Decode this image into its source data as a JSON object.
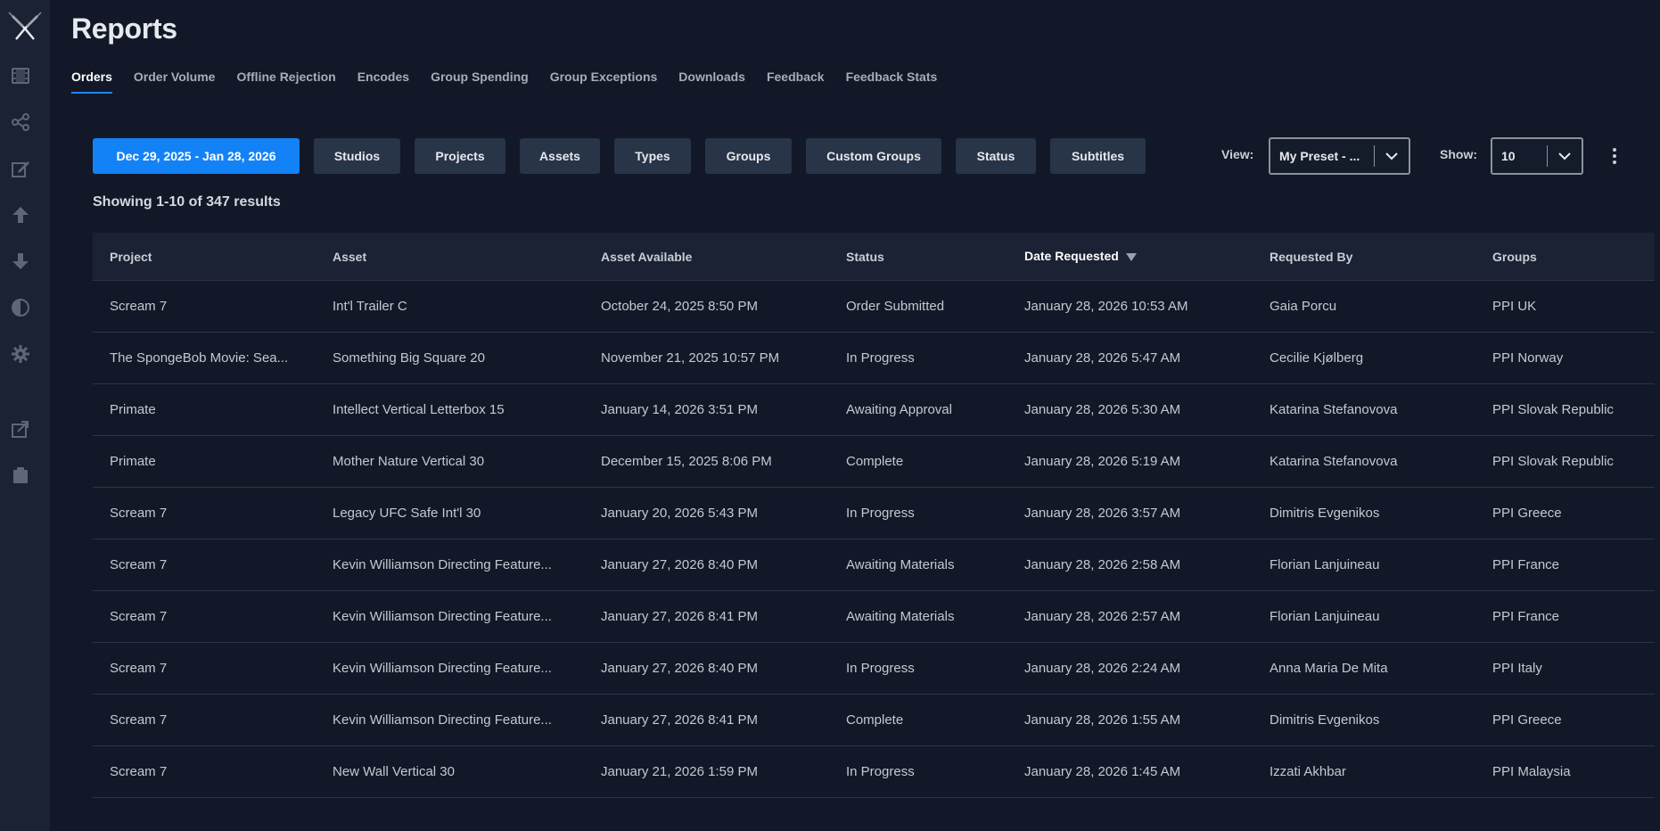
{
  "page": {
    "title": "Reports"
  },
  "sidebar": {
    "icons": [
      "logo-icon",
      "film-icon",
      "share-icon",
      "edit-icon",
      "upload-icon",
      "download-icon",
      "contrast-icon",
      "gear-icon",
      "export-icon",
      "clipboard-icon"
    ]
  },
  "tabs": [
    {
      "label": "Orders",
      "active": true
    },
    {
      "label": "Order Volume"
    },
    {
      "label": "Offline Rejection"
    },
    {
      "label": "Encodes"
    },
    {
      "label": "Group Spending"
    },
    {
      "label": "Group Exceptions"
    },
    {
      "label": "Downloads"
    },
    {
      "label": "Feedback"
    },
    {
      "label": "Feedback Stats"
    }
  ],
  "filters": {
    "date_range": "Dec 29, 2025 - Jan 28, 2026",
    "studios": "Studios",
    "projects": "Projects",
    "assets": "Assets",
    "types": "Types",
    "groups": "Groups",
    "custom_groups": "Custom Groups",
    "status": "Status",
    "subtitles": "Subtitles"
  },
  "view": {
    "label": "View:",
    "value": "My Preset - ..."
  },
  "show": {
    "label": "Show:",
    "value": "10"
  },
  "results_text": "Showing 1-10 of 347 results",
  "table": {
    "columns": {
      "project": "Project",
      "asset": "Asset",
      "asset_available": "Asset Available",
      "status": "Status",
      "date_requested": "Date Requested",
      "requested_by": "Requested By",
      "groups": "Groups"
    },
    "rows": [
      {
        "project": "Scream 7",
        "asset": "Int'l Trailer C",
        "asset_available": "October 24, 2025 8:50 PM",
        "status": "Order Submitted",
        "date_requested": "January 28, 2026 10:53 AM",
        "requested_by": "Gaia Porcu",
        "groups": "PPI UK"
      },
      {
        "project": "The SpongeBob Movie: Sea...",
        "asset": "Something Big Square 20",
        "asset_available": "November 21, 2025 10:57 PM",
        "status": "In Progress",
        "date_requested": "January 28, 2026 5:47 AM",
        "requested_by": "Cecilie Kjølberg",
        "groups": "PPI Norway"
      },
      {
        "project": "Primate",
        "asset": "Intellect Vertical Letterbox 15",
        "asset_available": "January 14, 2026 3:51 PM",
        "status": "Awaiting Approval",
        "date_requested": "January 28, 2026 5:30 AM",
        "requested_by": "Katarina Stefanovova",
        "groups": "PPI Slovak Republic"
      },
      {
        "project": "Primate",
        "asset": "Mother Nature Vertical 30",
        "asset_available": "December 15, 2025 8:06 PM",
        "status": "Complete",
        "date_requested": "January 28, 2026 5:19 AM",
        "requested_by": "Katarina Stefanovova",
        "groups": "PPI Slovak Republic"
      },
      {
        "project": "Scream 7",
        "asset": "Legacy UFC Safe Int'l 30",
        "asset_available": "January 20, 2026 5:43 PM",
        "status": "In Progress",
        "date_requested": "January 28, 2026 3:57 AM",
        "requested_by": "Dimitris Evgenikos",
        "groups": "PPI Greece"
      },
      {
        "project": "Scream 7",
        "asset": "Kevin Williamson Directing Feature...",
        "asset_available": "January 27, 2026 8:40 PM",
        "status": "Awaiting Materials",
        "date_requested": "January 28, 2026 2:58 AM",
        "requested_by": "Florian Lanjuineau",
        "groups": "PPI France"
      },
      {
        "project": "Scream 7",
        "asset": "Kevin Williamson Directing Feature...",
        "asset_available": "January 27, 2026 8:41 PM",
        "status": "Awaiting Materials",
        "date_requested": "January 28, 2026 2:57 AM",
        "requested_by": "Florian Lanjuineau",
        "groups": "PPI France"
      },
      {
        "project": "Scream 7",
        "asset": "Kevin Williamson Directing Feature...",
        "asset_available": "January 27, 2026 8:40 PM",
        "status": "In Progress",
        "date_requested": "January 28, 2026 2:24 AM",
        "requested_by": "Anna Maria De Mita",
        "groups": "PPI Italy"
      },
      {
        "project": "Scream 7",
        "asset": "Kevin Williamson Directing Feature...",
        "asset_available": "January 27, 2026 8:41 PM",
        "status": "Complete",
        "date_requested": "January 28, 2026 1:55 AM",
        "requested_by": "Dimitris Evgenikos",
        "groups": "PPI Greece"
      },
      {
        "project": "Scream 7",
        "asset": "New Wall Vertical 30",
        "asset_available": "January 21, 2026 1:59 PM",
        "status": "In Progress",
        "date_requested": "January 28, 2026 1:45 AM",
        "requested_by": "Izzati Akhbar",
        "groups": "PPI Malaysia"
      }
    ]
  },
  "colors": {
    "background": "#121827",
    "sidebar": "#1a2233",
    "accent": "#1482f7",
    "filter_button": "#283447"
  }
}
